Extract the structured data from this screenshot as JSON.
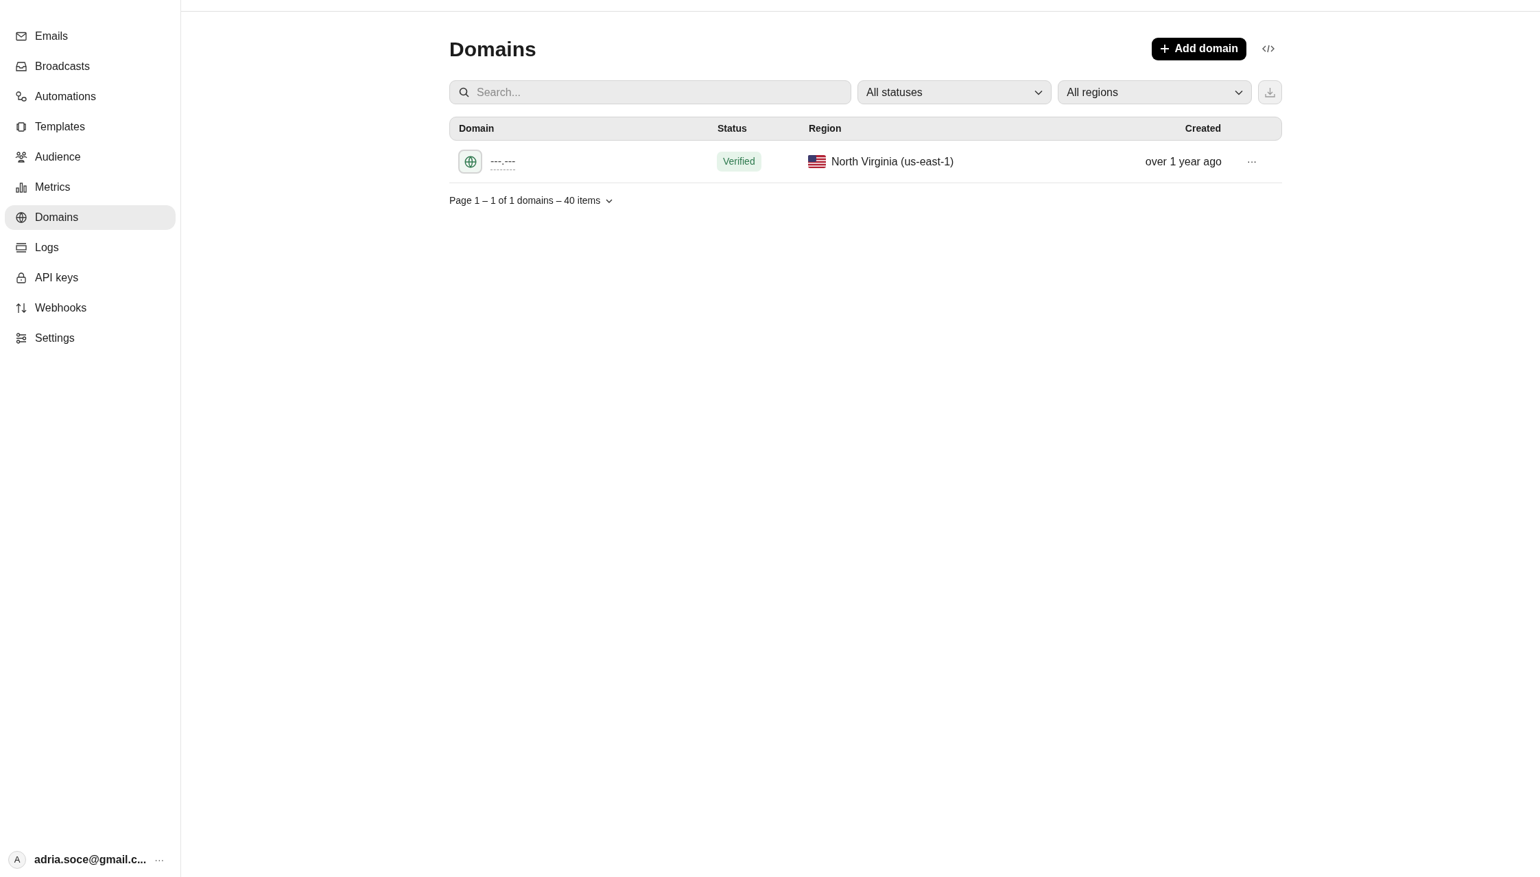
{
  "sidebar": {
    "items": [
      {
        "label": "Emails",
        "selected": false
      },
      {
        "label": "Broadcasts",
        "selected": false
      },
      {
        "label": "Automations",
        "selected": false
      },
      {
        "label": "Templates",
        "selected": false
      },
      {
        "label": "Audience",
        "selected": false
      },
      {
        "label": "Metrics",
        "selected": false
      },
      {
        "label": "Domains",
        "selected": true
      },
      {
        "label": "Logs",
        "selected": false
      },
      {
        "label": "API keys",
        "selected": false
      },
      {
        "label": "Webhooks",
        "selected": false
      },
      {
        "label": "Settings",
        "selected": false
      }
    ],
    "user": {
      "avatar": "A",
      "email": "adria.soce@gmail.c...",
      "more": "···"
    }
  },
  "page": {
    "title": "Domains",
    "add_button": "Add domain"
  },
  "filters": {
    "search": {
      "placeholder": "Search..."
    },
    "status": "All statuses",
    "region": "All regions"
  },
  "table": {
    "columns": [
      "Domain",
      "Status",
      "Region",
      "Created"
    ],
    "rows": [
      {
        "domain": "---.---",
        "status": "Verified",
        "region": "North Virginia (us-east-1)",
        "created": "over 1 year ago",
        "more": "···"
      }
    ]
  },
  "pagination": "Page 1 – 1 of 1 domains – 40 items"
}
